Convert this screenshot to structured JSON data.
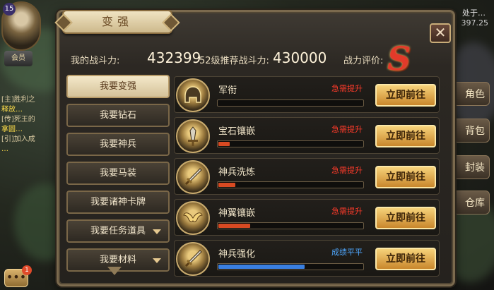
{
  "panel": {
    "title": "变强",
    "close_label": "✕"
  },
  "power": {
    "my_label": "我的战斗力:",
    "my_value": "432399",
    "recommend_label": "52级推荐战斗力:",
    "recommend_value": "430000",
    "rating_label": "战力评价:",
    "rating_grade": "S"
  },
  "menu": {
    "items": [
      {
        "label": "我要变强",
        "active": true,
        "arrow": false
      },
      {
        "label": "我要钻石",
        "active": false,
        "arrow": false
      },
      {
        "label": "我要神兵",
        "active": false,
        "arrow": false
      },
      {
        "label": "我要马装",
        "active": false,
        "arrow": false
      },
      {
        "label": "我要诸神卡牌",
        "active": false,
        "arrow": false
      },
      {
        "label": "我要任务道具",
        "active": false,
        "arrow": true
      },
      {
        "label": "我要材料",
        "active": false,
        "arrow": true
      }
    ]
  },
  "rows": [
    {
      "name": "军衔",
      "status": "急需提升",
      "status_color": "#ff3b2a",
      "progress": 0.0,
      "bar_color": "#d84a22",
      "button": "立即前往",
      "icon": "helmet-icon"
    },
    {
      "name": "宝石镶嵌",
      "status": "急需提升",
      "status_color": "#ff3b2a",
      "progress": 0.08,
      "bar_color": "#d84a22",
      "button": "立即前往",
      "icon": "gem-sword-icon"
    },
    {
      "name": "神兵洗炼",
      "status": "急需提升",
      "status_color": "#ff3b2a",
      "progress": 0.12,
      "bar_color": "#d84a22",
      "button": "立即前往",
      "icon": "sword-icon"
    },
    {
      "name": "神翼镶嵌",
      "status": "急需提升",
      "status_color": "#ff3b2a",
      "progress": 0.22,
      "bar_color": "#d84a22",
      "button": "立即前往",
      "icon": "wings-icon"
    },
    {
      "name": "神兵强化",
      "status": "成绩平平",
      "status_color": "#4fa8ff",
      "progress": 0.6,
      "bar_color": "#3a7fe0",
      "button": "立即前往",
      "icon": "sword-icon"
    }
  ],
  "background": {
    "vip_label": "会员",
    "chat_lines": [
      "[主]胜利之",
      "释放…",
      "[传]死王的",
      "拿圆…",
      "[引]加入成",
      "…"
    ],
    "top_right_label": "处于…",
    "top_right_value": "397.25",
    "side_buttons": [
      "角色",
      "背包",
      "封装",
      "仓库"
    ],
    "chat_badge": "1"
  }
}
